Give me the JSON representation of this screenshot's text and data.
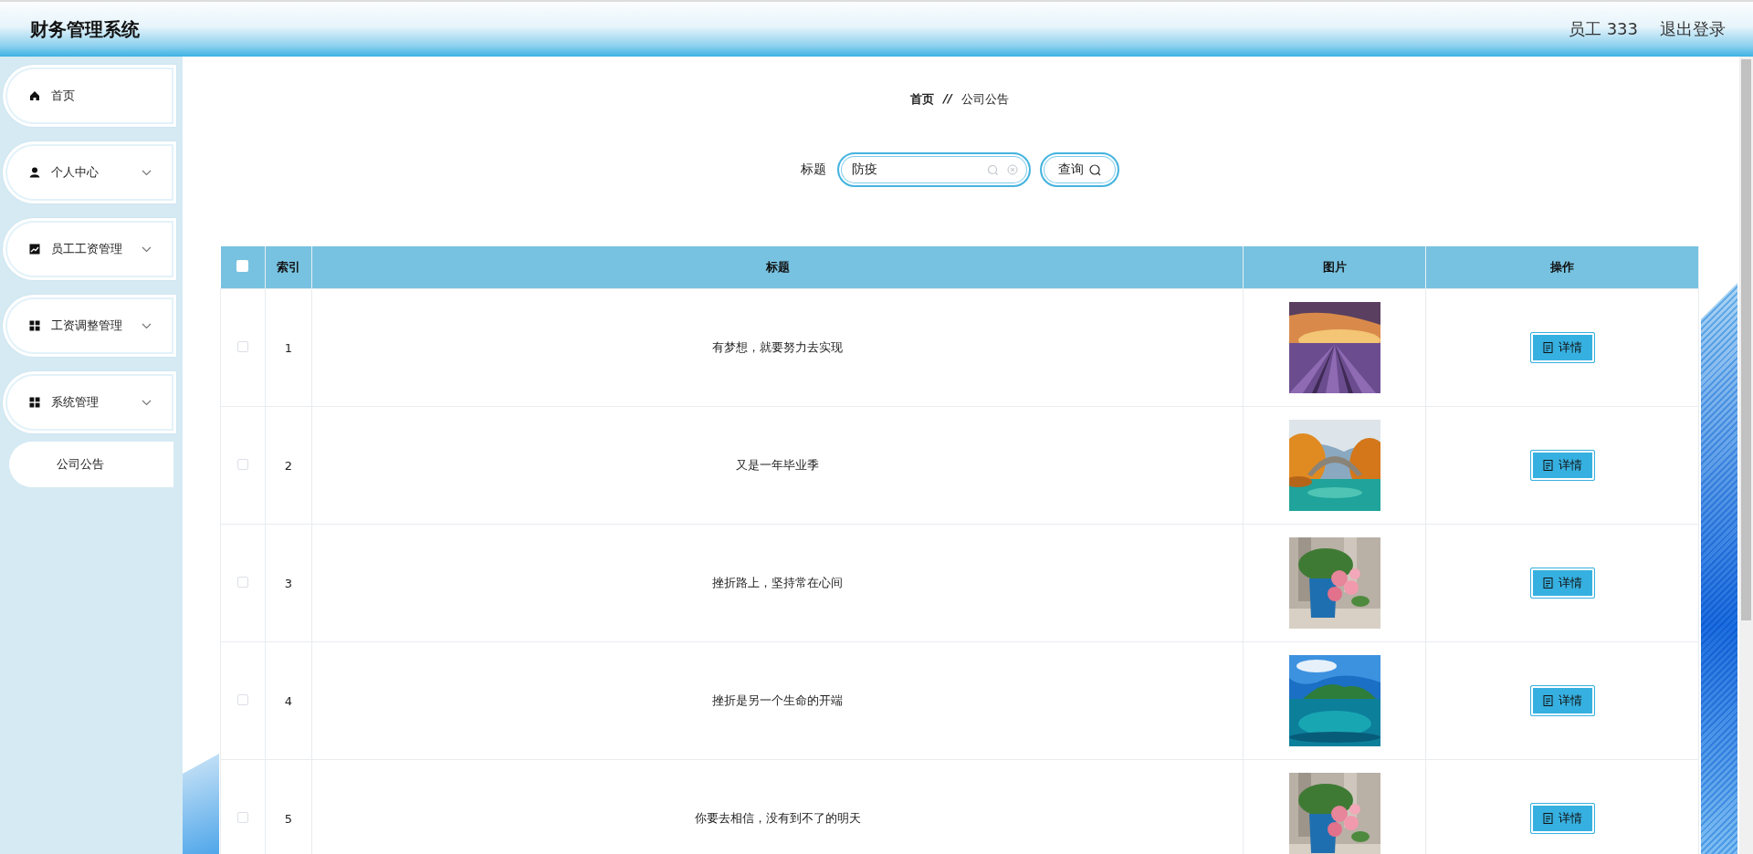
{
  "header": {
    "title": "财务管理系统",
    "user": "员工 333",
    "logout": "退出登录"
  },
  "sidebar": {
    "items": [
      {
        "label": "首页",
        "kind": "link"
      },
      {
        "label": "个人中心",
        "kind": "submenu"
      },
      {
        "label": "员工工资管理",
        "kind": "submenu"
      },
      {
        "label": "工资调整管理",
        "kind": "submenu"
      },
      {
        "label": "系统管理",
        "kind": "submenu",
        "children": [
          {
            "label": "公司公告"
          }
        ]
      }
    ]
  },
  "breadcrumb": {
    "items": [
      "首页",
      "公司公告"
    ],
    "separator": "//"
  },
  "search": {
    "label": "标题",
    "value": "防疫",
    "button": "查询"
  },
  "table": {
    "select_all_checked": false,
    "columns": [
      "索引",
      "标题",
      "图片",
      "操作"
    ],
    "rows": [
      {
        "checked": false,
        "index": "1",
        "title": "有梦想，就要努力去实现",
        "action": "详情"
      },
      {
        "checked": false,
        "index": "2",
        "title": "又是一年毕业季",
        "action": "详情"
      },
      {
        "checked": false,
        "index": "3",
        "title": "挫折路上，坚持常在心间",
        "action": "详情"
      },
      {
        "checked": false,
        "index": "4",
        "title": "挫折是另一个生命的开端",
        "action": "详情"
      },
      {
        "checked": false,
        "index": "5",
        "title": "你要去相信，没有到不了的明天",
        "action": "详情"
      }
    ]
  }
}
